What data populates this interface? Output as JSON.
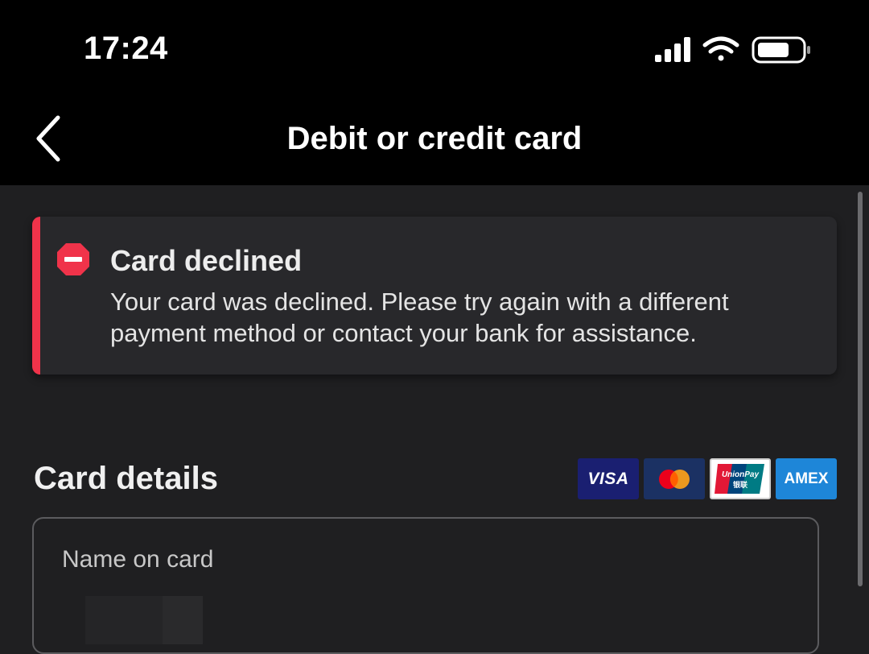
{
  "status_bar": {
    "time": "17:24",
    "icons": [
      "cellular-signal-icon",
      "wifi-icon",
      "battery-icon"
    ]
  },
  "nav": {
    "title": "Debit or credit card",
    "back_icon": "chevron-left-icon"
  },
  "alert": {
    "icon": "stop-sign-icon",
    "title": "Card declined",
    "message": "Your card was declined. Please try again with a different payment method or contact your bank for assistance.",
    "accent_color": "#f0334a"
  },
  "card_details": {
    "title": "Card details",
    "accepted_cards": [
      "VISA",
      "Mastercard",
      "UnionPay",
      "AMEX"
    ],
    "visa_label": "VISA",
    "unionpay_label": "UnionPay",
    "unionpay_sub": "银联",
    "amex_label": "AMEX"
  },
  "form": {
    "name_label": "Name on card",
    "name_value": ""
  },
  "colors": {
    "background": "#1f1f21",
    "header": "#000000",
    "alert_bg": "#28282b",
    "field_border": "#5b5b5e"
  }
}
